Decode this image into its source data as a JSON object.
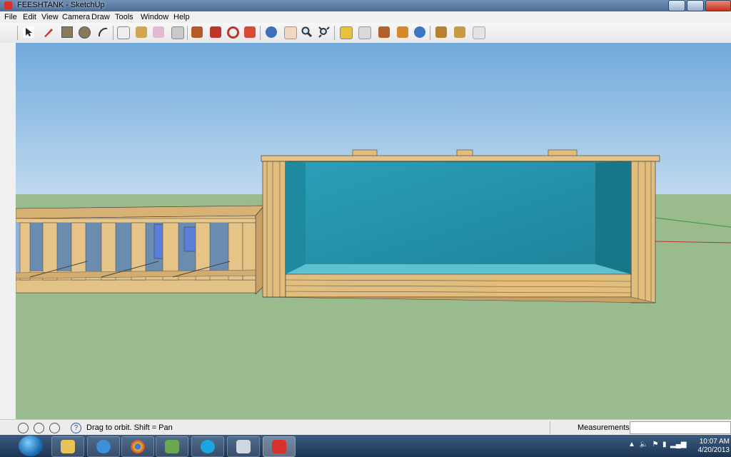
{
  "window": {
    "title": "FEESHTANK - SketchUp"
  },
  "menu": [
    "File",
    "Edit",
    "View",
    "Camera",
    "Draw",
    "Tools",
    "Window",
    "Help"
  ],
  "toolbar": {
    "tools": [
      "select-icon",
      "pencil-icon",
      "rectangle-icon",
      "circle-icon",
      "arc-icon",
      "make-component-icon",
      "paint-bucket-icon",
      "eraser-icon",
      "tape-measure-icon",
      "push-pull-icon",
      "move-icon",
      "rotate-icon",
      "offset-icon",
      "orbit-icon",
      "pan-icon",
      "zoom-icon",
      "zoom-extents-icon",
      "section-plane-icon",
      "previous-view-icon",
      "walk-icon",
      "position-camera-icon",
      "look-around-icon",
      "get-models-icon",
      "share-model-icon",
      "get-components-icon"
    ]
  },
  "status": {
    "message": "Drag to orbit.  Shift = Pan",
    "measurements_label": "Measurements",
    "measurements_value": ""
  },
  "taskbar": {
    "apps": [
      "windows-explorer-icon",
      "internet-explorer-icon",
      "chrome-icon",
      "people-icon",
      "skype-icon",
      "paint-icon",
      "sketchup-icon"
    ],
    "time": "10:07 AM",
    "date": "4/20/2013"
  },
  "colors": {
    "sky": "#7fb4de",
    "ground": "#99b98c",
    "wood": "#e2bd7c",
    "water": "#2a9db5"
  }
}
